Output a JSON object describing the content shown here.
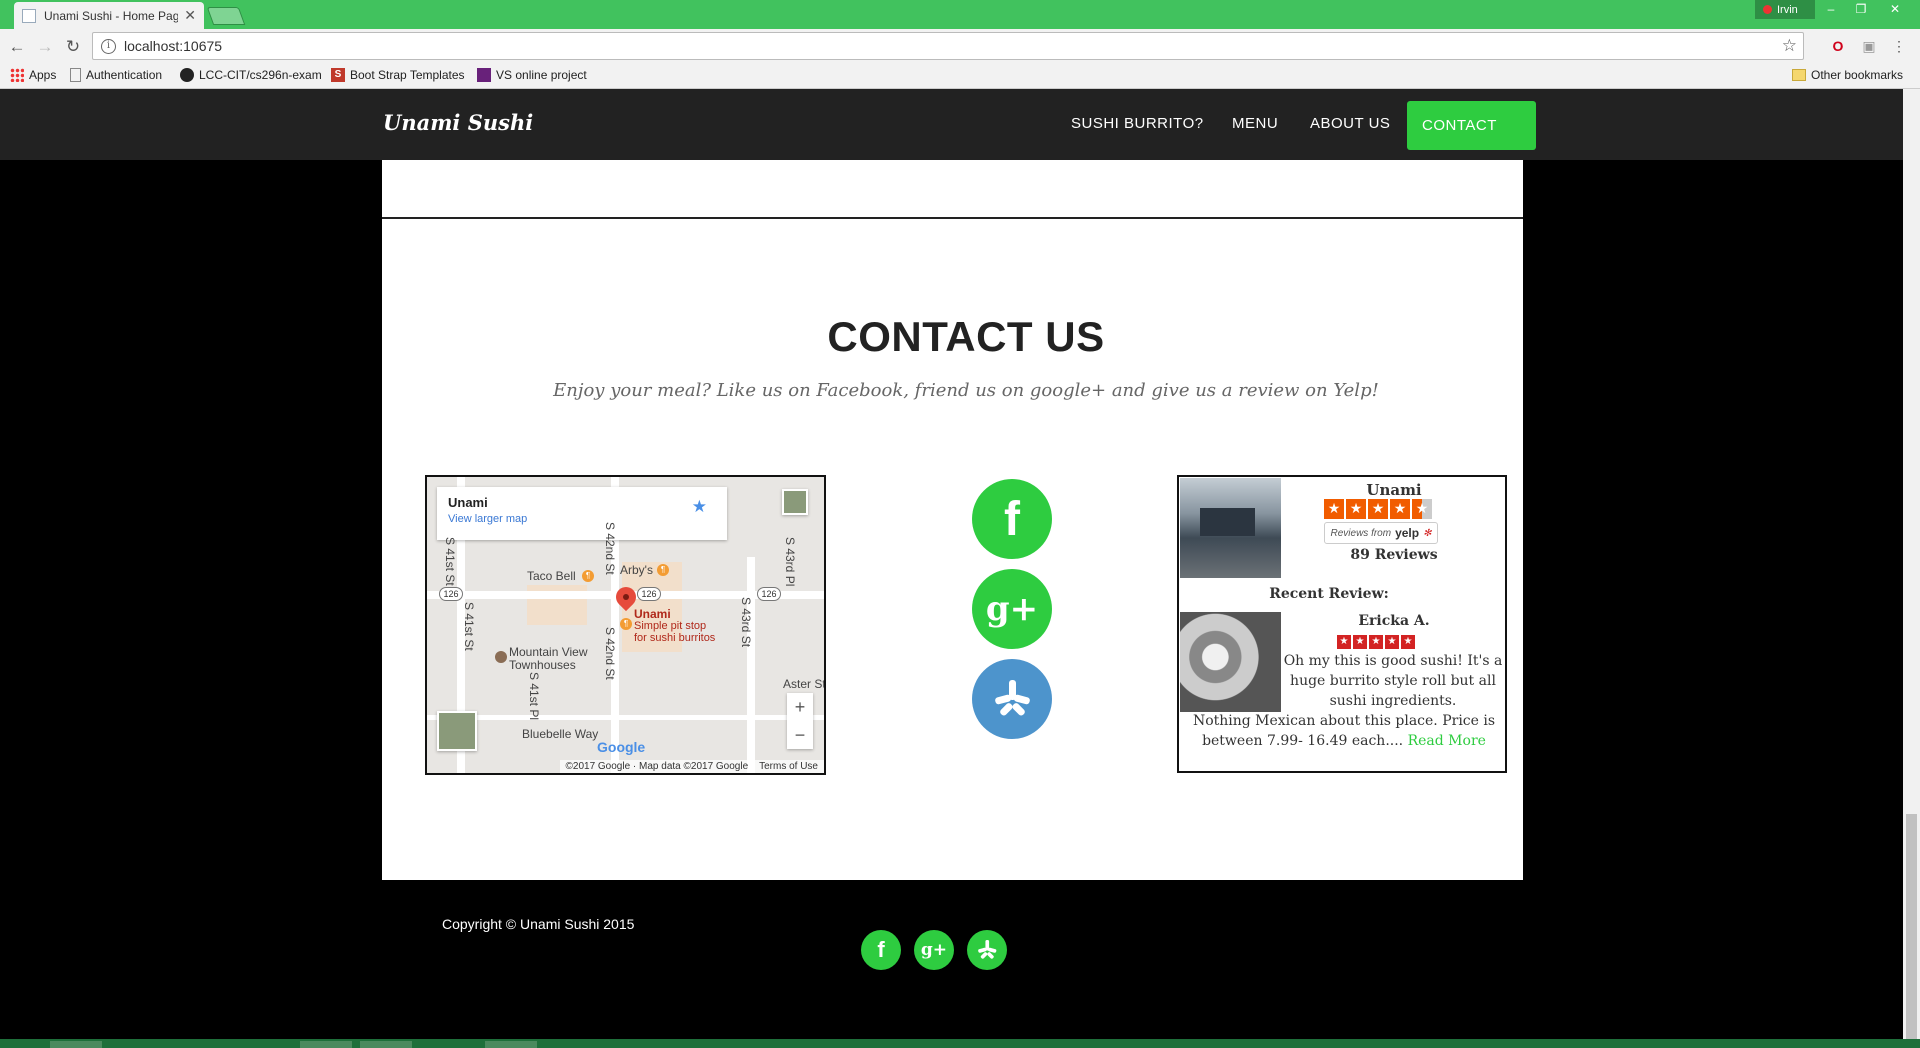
{
  "browser": {
    "tab_title": "Unami Sushi - Home Pag",
    "url": "localhost:10675",
    "user": "Irvin",
    "bookmarks": [
      {
        "label": "Apps"
      },
      {
        "label": "Authentication"
      },
      {
        "label": "LCC-CIT/cs296n-exam"
      },
      {
        "label": "Boot Strap Templates"
      },
      {
        "label": "VS online project"
      }
    ],
    "other_bookmarks": "Other bookmarks"
  },
  "nav": {
    "brand": "Unami Sushi",
    "links": [
      "SUSHI BURRITO?",
      "MENU",
      "ABOUT US",
      "CONTACT US"
    ],
    "active_color": "#2ecc40"
  },
  "contact": {
    "title": "CONTACT US",
    "subtitle": "Enjoy your meal? Like us on Facebook, friend us on google+ and give us a review on Yelp!"
  },
  "map": {
    "place_name": "Unami",
    "view_larger": "View larger map",
    "pin_title": "Unami",
    "pin_desc_1": "Simple pit stop",
    "pin_desc_2": "for sushi burritos",
    "poi": [
      "Taco Bell",
      "Arby's",
      "Mountain View",
      "Townhouses",
      "Aster St",
      "Bluebelle Way"
    ],
    "streets": [
      "S 41st St",
      "S 41st St",
      "S 42nd St",
      "S 42nd St",
      "S 43rd St",
      "S 43rd Pl",
      "S 41st Pl"
    ],
    "route": "126",
    "attribution": "©2017 Google · Map data ©2017 Google",
    "terms": "Terms of Use",
    "google": "Google",
    "zoom_in": "+",
    "zoom_out": "−"
  },
  "social": {
    "facebook_glyph": "f",
    "google_glyph": "g+",
    "icons": [
      "facebook-icon",
      "google-plus-icon",
      "yelp-icon"
    ]
  },
  "yelp": {
    "business": "Unami",
    "rating": 4.5,
    "reviews_from": "Reviews from",
    "yelp_word": "yelp",
    "review_count": "89 Reviews",
    "recent_label": "Recent Review:",
    "reviewer": "Ericka A.",
    "reviewer_rating": 5,
    "review_text_1": "Oh my this is good sushi! It's a huge burrito style roll but all sushi ingredients.",
    "review_text_2": "Nothing Mexican about this place. Price is between 7.99- 16.49 each....",
    "read_more": "Read More"
  },
  "footer": {
    "copyright": "Copyright © Unami Sushi 2015"
  }
}
